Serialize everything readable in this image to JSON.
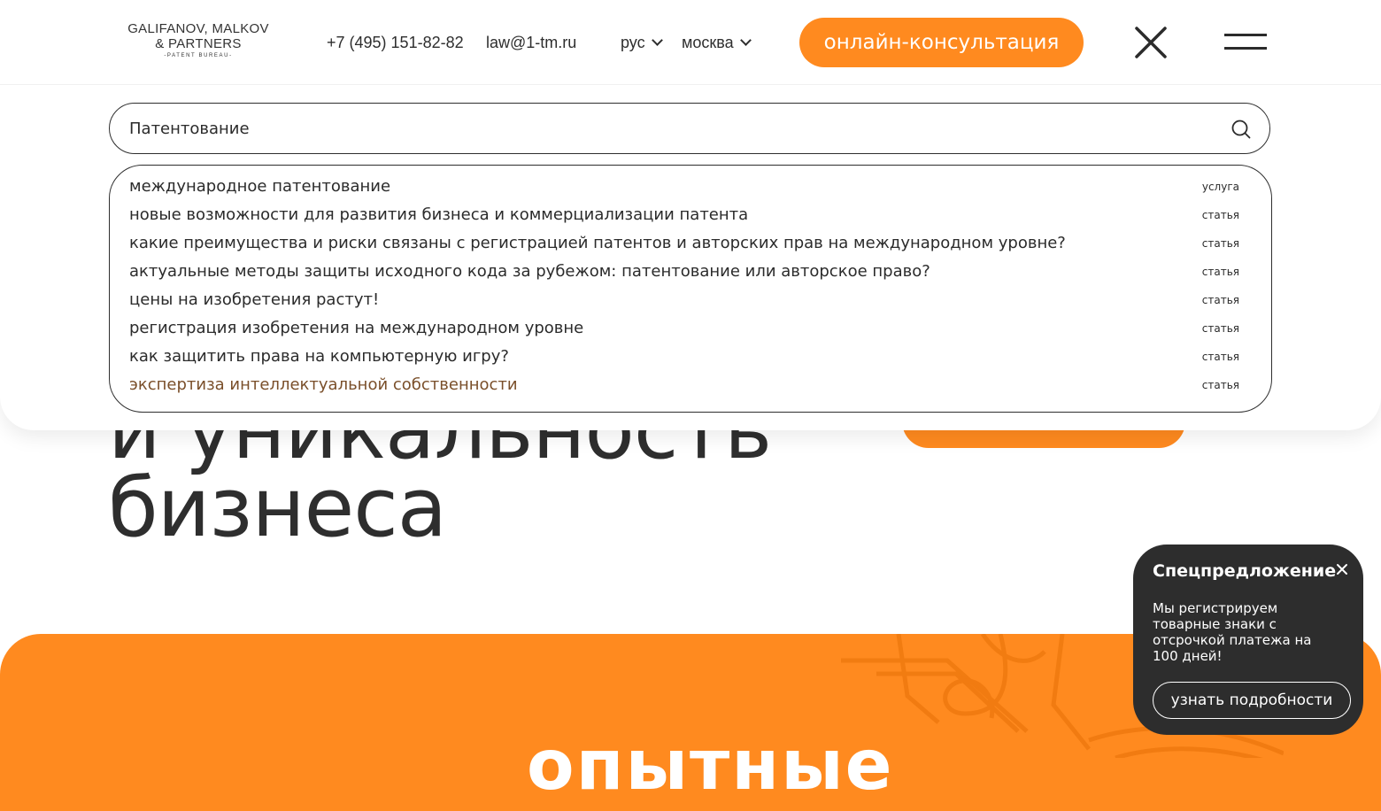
{
  "header": {
    "logo": {
      "line1": "GALIFANOV, MALKOV",
      "line2": "& PARTNERS",
      "line3": "-PATENT BUREAU-"
    },
    "phone": "+7 (495) 151-82-82",
    "email": "law@1-tm.ru",
    "language": "рус",
    "city": "москва",
    "consult_label": "онлайн-консультация",
    "colors": {
      "accent": "#ff8a1f",
      "text": "#2b2b2b"
    }
  },
  "search": {
    "value": "Патентование",
    "placeholder": "",
    "results": [
      {
        "title": "международное патентование",
        "type": "услуга"
      },
      {
        "title": "новые возможности для развития бизнеса и коммерциализации патента",
        "type": "статья"
      },
      {
        "title": "какие преимущества и риски связаны с регистрацией патентов и авторских прав на международном уровне?",
        "type": "статья"
      },
      {
        "title": "актуальные методы защиты исходного кода за рубежом: патентование или авторское право?",
        "type": "статья"
      },
      {
        "title": "цены на изобретения растут!",
        "type": "статья"
      },
      {
        "title": "регистрация изобретения на международном уровне",
        "type": "статья"
      },
      {
        "title": "как защитить права на компьютерную игру?",
        "type": "статья"
      },
      {
        "title": "экспертиза интеллектуальной собственности",
        "type": "статья"
      }
    ]
  },
  "hero": {
    "line1": "и уникальность",
    "line2": "бизнеса"
  },
  "section": {
    "heading": "опытные"
  },
  "promo": {
    "title": "Спецпредложение",
    "text": "Мы регистрируем товарные знаки с отсрочкой платежа на 100 дней!",
    "button_label": "узнать подробности"
  }
}
